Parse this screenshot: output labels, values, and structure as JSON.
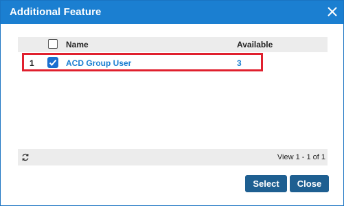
{
  "dialog": {
    "title": "Additional Feature",
    "close_icon": "close-icon"
  },
  "grid": {
    "columns": [
      "Name",
      "Available"
    ],
    "rows": [
      {
        "index": "1",
        "checked": true,
        "name": "ACD Group User",
        "available": "3"
      }
    ],
    "footer": {
      "refresh_icon": "refresh-icon",
      "pager_text": "View 1 - 1 of 1"
    }
  },
  "buttons": {
    "select_label": "Select",
    "close_label": "Close"
  },
  "colors": {
    "titlebar": "#1b7fd1",
    "link": "#1b7fd1",
    "button": "#1e5f91",
    "highlight": "#e0202e",
    "header_bg": "#ececec"
  }
}
